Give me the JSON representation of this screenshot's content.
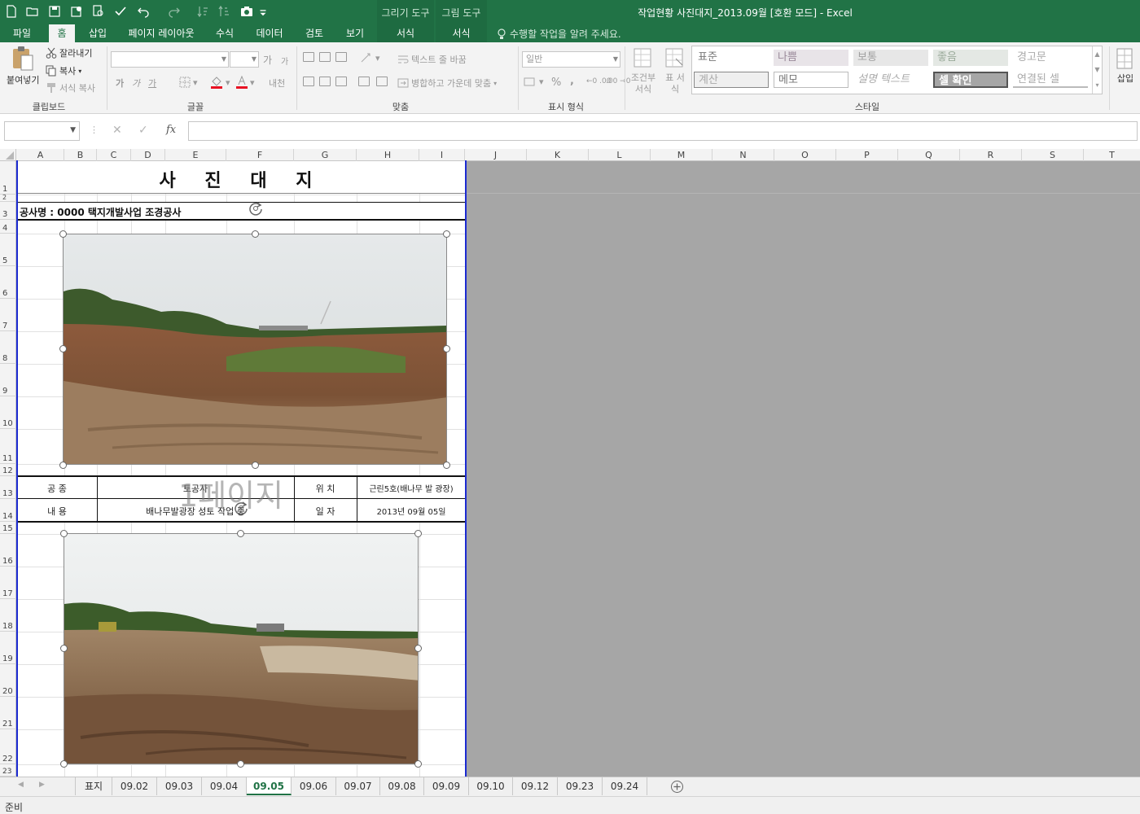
{
  "window": {
    "title": "작업현황 사진대지_2013.09월  [호환 모드] - Excel",
    "context_groups": [
      "그리기 도구",
      "그림 도구"
    ]
  },
  "ribbon_tabs": [
    "파일",
    "홈",
    "삽입",
    "페이지 레이아웃",
    "수식",
    "데이터",
    "검토",
    "보기",
    "서식",
    "서식"
  ],
  "active_tab": "홈",
  "tell_me": "수행할 작업을 알려 주세요.",
  "clipboard": {
    "paste": "붙여넣기",
    "cut": "잘라내기",
    "copy": "복사",
    "format_painter": "서식 복사",
    "label": "클립보드"
  },
  "font_group": {
    "label": "글꼴",
    "grow": "가",
    "shrink": "가",
    "bold": "가",
    "italic": "가",
    "underline": "가",
    "phonetic": "내천"
  },
  "alignment": {
    "wrap_text": "텍스트 줄 바꿈",
    "merge": "병합하고 가운데 맞춤",
    "label": "맞춤"
  },
  "number": {
    "format": "일반",
    "percent": "%",
    "comma": ",",
    "inc_dec": "←0 .00",
    "dec_dec": ".00 →0",
    "label": "표시 형식"
  },
  "styles": {
    "conditional": "조건부 서식",
    "table": "표 서식",
    "label": "스타일",
    "cells": [
      {
        "name": "표준",
        "bg": "#ffffff",
        "fg": "#777777"
      },
      {
        "name": "나쁨",
        "bg": "#e8e4e8",
        "fg": "#9a8a9a"
      },
      {
        "name": "보통",
        "bg": "#e7e7e7",
        "fg": "#a0a0a0"
      },
      {
        "name": "좋음",
        "bg": "#e4e8e4",
        "fg": "#9aaa9a"
      },
      {
        "name": "경고문",
        "bg": "#ffffff",
        "fg": "#aaaaaa"
      },
      {
        "name": "계산",
        "bg": "#efefef",
        "fg": "#aaaaaa"
      },
      {
        "name": "메모",
        "bg": "#ffffff",
        "fg": "#777777"
      },
      {
        "name": "설명 텍스트",
        "bg": "#ffffff",
        "fg": "#aaaaaa"
      },
      {
        "name": "셀 확인",
        "bg": "#a6a6a6",
        "fg": "#ffffff"
      },
      {
        "name": "연결된 셀",
        "bg": "#ffffff",
        "fg": "#aaaaaa"
      }
    ]
  },
  "cells_group": {
    "insert": "삽입"
  },
  "formula_bar": {
    "name_box": "",
    "fx": "fx",
    "value": ""
  },
  "columns": [
    "A",
    "B",
    "C",
    "D",
    "E",
    "F",
    "G",
    "H",
    "I",
    "J",
    "K",
    "L",
    "M",
    "N",
    "O",
    "P",
    "Q",
    "R",
    "S",
    "T"
  ],
  "rows": [
    "1",
    "2",
    "3",
    "4",
    "5",
    "6",
    "7",
    "8",
    "9",
    "10",
    "11",
    "12",
    "13",
    "14",
    "15",
    "16",
    "17",
    "18",
    "19",
    "20",
    "21",
    "22",
    "23"
  ],
  "sheet_content": {
    "title": "사 진 대 지",
    "project": "공사명 : 0000 택지개발사업 조경공사",
    "info_table": [
      {
        "label1": "공    종",
        "value1": "토공사",
        "label2": "위    치",
        "value2": "근린5호(배나무 발 광장)"
      },
      {
        "label1": "내    용",
        "value1": "배나무발광장 성토 작업 중",
        "label2": "일    자",
        "value2": "2013년 09월 05일"
      }
    ],
    "page_watermark": "1페이지"
  },
  "sheet_tabs": [
    "표지",
    "09.02",
    "09.03",
    "09.04",
    "09.05",
    "09.06",
    "09.07",
    "09.08",
    "09.09",
    "09.10",
    "09.12",
    "09.23",
    "09.24"
  ],
  "active_sheet": "09.05",
  "status": "준비",
  "colors": {
    "excel_green": "#217346",
    "page_break": "#1c2bd1"
  }
}
